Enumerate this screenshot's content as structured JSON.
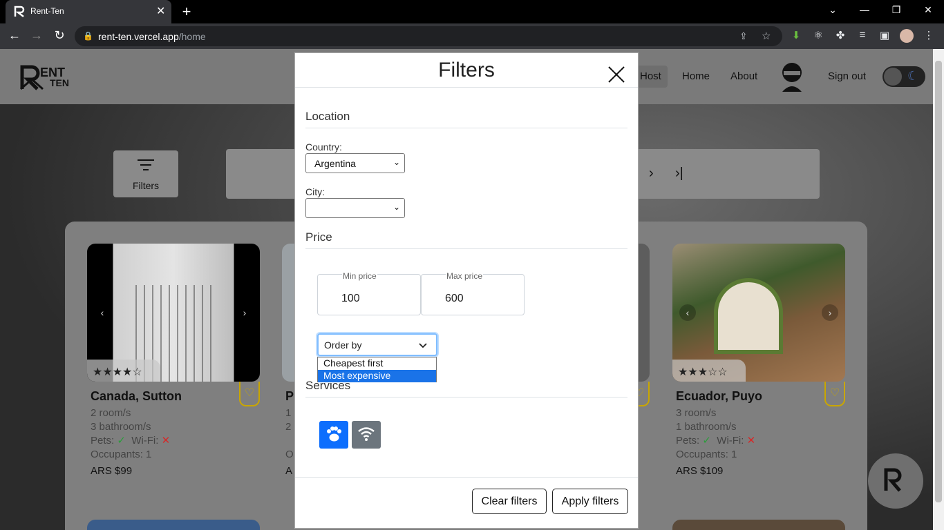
{
  "browser": {
    "tab_title": "Rent-Ten",
    "url_domain": "rent-ten.vercel.app",
    "url_path": "/home"
  },
  "nav": {
    "host": "Host",
    "home": "Home",
    "about": "About",
    "signout": "Sign out"
  },
  "filters_button": "Filters",
  "cards": [
    {
      "title": "Canada, Sutton",
      "rooms": "2 room/s",
      "baths": "3 bathroom/s",
      "pets": "Pets:",
      "wifi": "Wi-Fi:",
      "occupants": "Occupants: 1",
      "price": "ARS $99",
      "rating": 4
    },
    {
      "title": "P",
      "rooms": "1",
      "baths": "2",
      "occupants": "O",
      "price": "A"
    },
    {
      "title": "Ecuador, Puyo",
      "rooms": "3 room/s",
      "baths": "1 bathroom/s",
      "pets": "Pets:",
      "wifi": "Wi-Fi:",
      "occupants": "Occupants: 1",
      "price": "ARS $109",
      "rating": 3
    }
  ],
  "modal": {
    "title": "Filters",
    "location_section": "Location",
    "country_label": "Country:",
    "country_value": "Argentina",
    "city_label": "City:",
    "city_value": "",
    "price_section": "Price",
    "min_price_label": "Min price",
    "min_price_value": "100",
    "max_price_label": "Max price",
    "max_price_value": "600",
    "order_by": "Order by",
    "order_options": [
      "Cheapest first",
      "Most expensive"
    ],
    "order_highlighted": "Most expensive",
    "services_section": "Services",
    "clear_button": "Clear filters",
    "apply_button": "Apply filters"
  },
  "colors": {
    "accent": "#0d6efd",
    "service_inactive": "#6c757d",
    "heart": "#c9a600",
    "check": "#2a9d3a",
    "cross": "#d62828"
  }
}
